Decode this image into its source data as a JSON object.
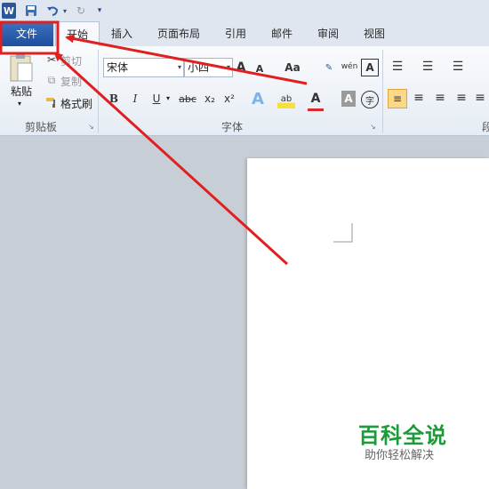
{
  "qat": {
    "app_icon": "W"
  },
  "tabs": [
    "文件",
    "开始",
    "插入",
    "页面布局",
    "引用",
    "邮件",
    "审阅",
    "视图"
  ],
  "clipboard": {
    "paste": "粘贴",
    "cut": "剪切",
    "copy": "复制",
    "format_painter": "格式刷",
    "label": "剪贴板"
  },
  "font": {
    "name": "宋体",
    "size": "小四",
    "label": "字体",
    "bold": "B",
    "italic": "I",
    "underline": "U",
    "strike": "abc",
    "sub": "x₂",
    "sup": "x²",
    "grow": "A",
    "shrink": "A",
    "case": "Aa",
    "phonetic": "wén",
    "border": "A",
    "effects": "A",
    "char_shade": "A",
    "enclose": "字"
  },
  "paragraph": {
    "label": "段"
  },
  "watermark": {
    "title": "百科全说",
    "subtitle": "助你轻松解决"
  },
  "colors": {
    "file_tab": "#2a5fae",
    "annotation_red": "#e02020",
    "highlight_yellow": "#f6e03a",
    "font_red": "#d92b2b"
  }
}
